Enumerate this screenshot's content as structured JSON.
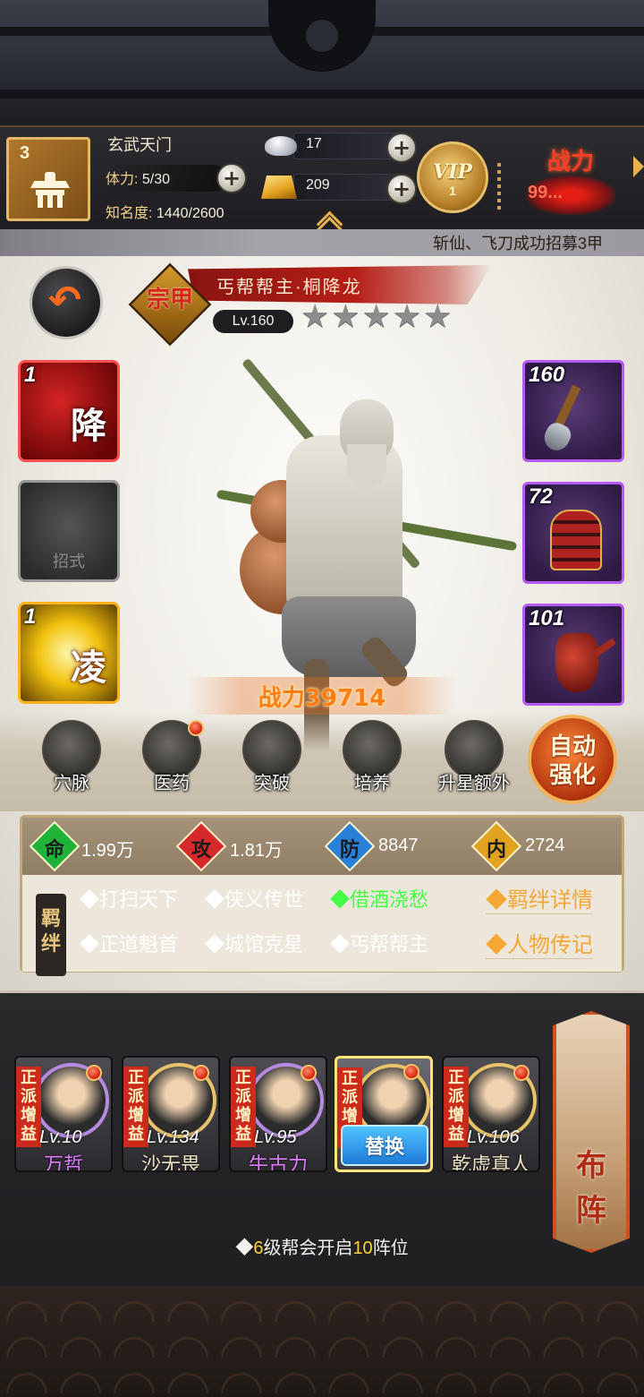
{
  "header": {
    "level": "3",
    "sect_name": "玄武天门",
    "stamina_label": "体力:",
    "stamina_value": "5/30",
    "fame_label": "知名度:",
    "fame_value": "1440/2600",
    "silver": "17",
    "gold": "209",
    "vip_text": "VIP",
    "vip_level": "1",
    "power_label": "战力",
    "power_value": "99..."
  },
  "marquee": "斩仙、飞刀成功招募3甲",
  "character": {
    "sect_badge": "宗甲",
    "title_name": "丐帮帮主·桐降龙",
    "level": "Lv.160",
    "stars_filled": 0,
    "stars_total": 5,
    "combat_power": "战力39714"
  },
  "skills": [
    {
      "count": "1",
      "char": "降"
    },
    {
      "count": "",
      "label": "招式"
    },
    {
      "count": "1",
      "char": "凌"
    }
  ],
  "equipment": [
    {
      "count": "160",
      "icon": "shovel-icon"
    },
    {
      "count": "72",
      "icon": "armor-icon"
    },
    {
      "count": "101",
      "icon": "teapot-icon"
    }
  ],
  "actions": [
    {
      "label": "穴脉",
      "icon": "meridian-icon"
    },
    {
      "label": "医药",
      "icon": "medicine-icon"
    },
    {
      "label": "突破",
      "icon": "breakthrough-icon"
    },
    {
      "label": "培养",
      "icon": "cultivate-icon"
    },
    {
      "label": "升星额外",
      "icon": "star-up-icon"
    }
  ],
  "auto_enhance": {
    "line1": "自动",
    "line2": "强化"
  },
  "stats": [
    {
      "badge": "命",
      "value": "1.99万",
      "color": "#1fb33a"
    },
    {
      "badge": "攻",
      "value": "1.81万",
      "color": "#d62a2a"
    },
    {
      "badge": "防",
      "value": "8847",
      "color": "#2a7fd6"
    },
    {
      "badge": "内",
      "value": "2724",
      "color": "#e0a21f"
    }
  ],
  "bonds": {
    "tag": "羁绊",
    "row1": [
      "◆打扫天下",
      "◆侠义传世",
      "◆借酒浇愁"
    ],
    "row2": [
      "◆正道魁首",
      "◆城馆克星",
      "◆丐帮帮主"
    ],
    "details_link": "◆羁绊详情",
    "bio_link": "◆人物传记"
  },
  "lineup": [
    {
      "tag": "正派增益",
      "level": "Lv.10",
      "name": "万哲"
    },
    {
      "tag": "正派增益",
      "level": "Lv.134",
      "name": "沙无畏"
    },
    {
      "tag": "正派增益",
      "level": "Lv.95",
      "name": "牛古力"
    },
    {
      "tag": "正派增益",
      "replace_label": "替换"
    },
    {
      "tag": "正派增益",
      "level": "Lv.106",
      "name": "乾虚真人"
    }
  ],
  "formation": {
    "label_top": "布",
    "label_bottom": "阵"
  },
  "tip": {
    "prefix": "◆",
    "num1": "6",
    "mid": "级帮会开启",
    "num2": "10",
    "suffix": "阵位"
  }
}
